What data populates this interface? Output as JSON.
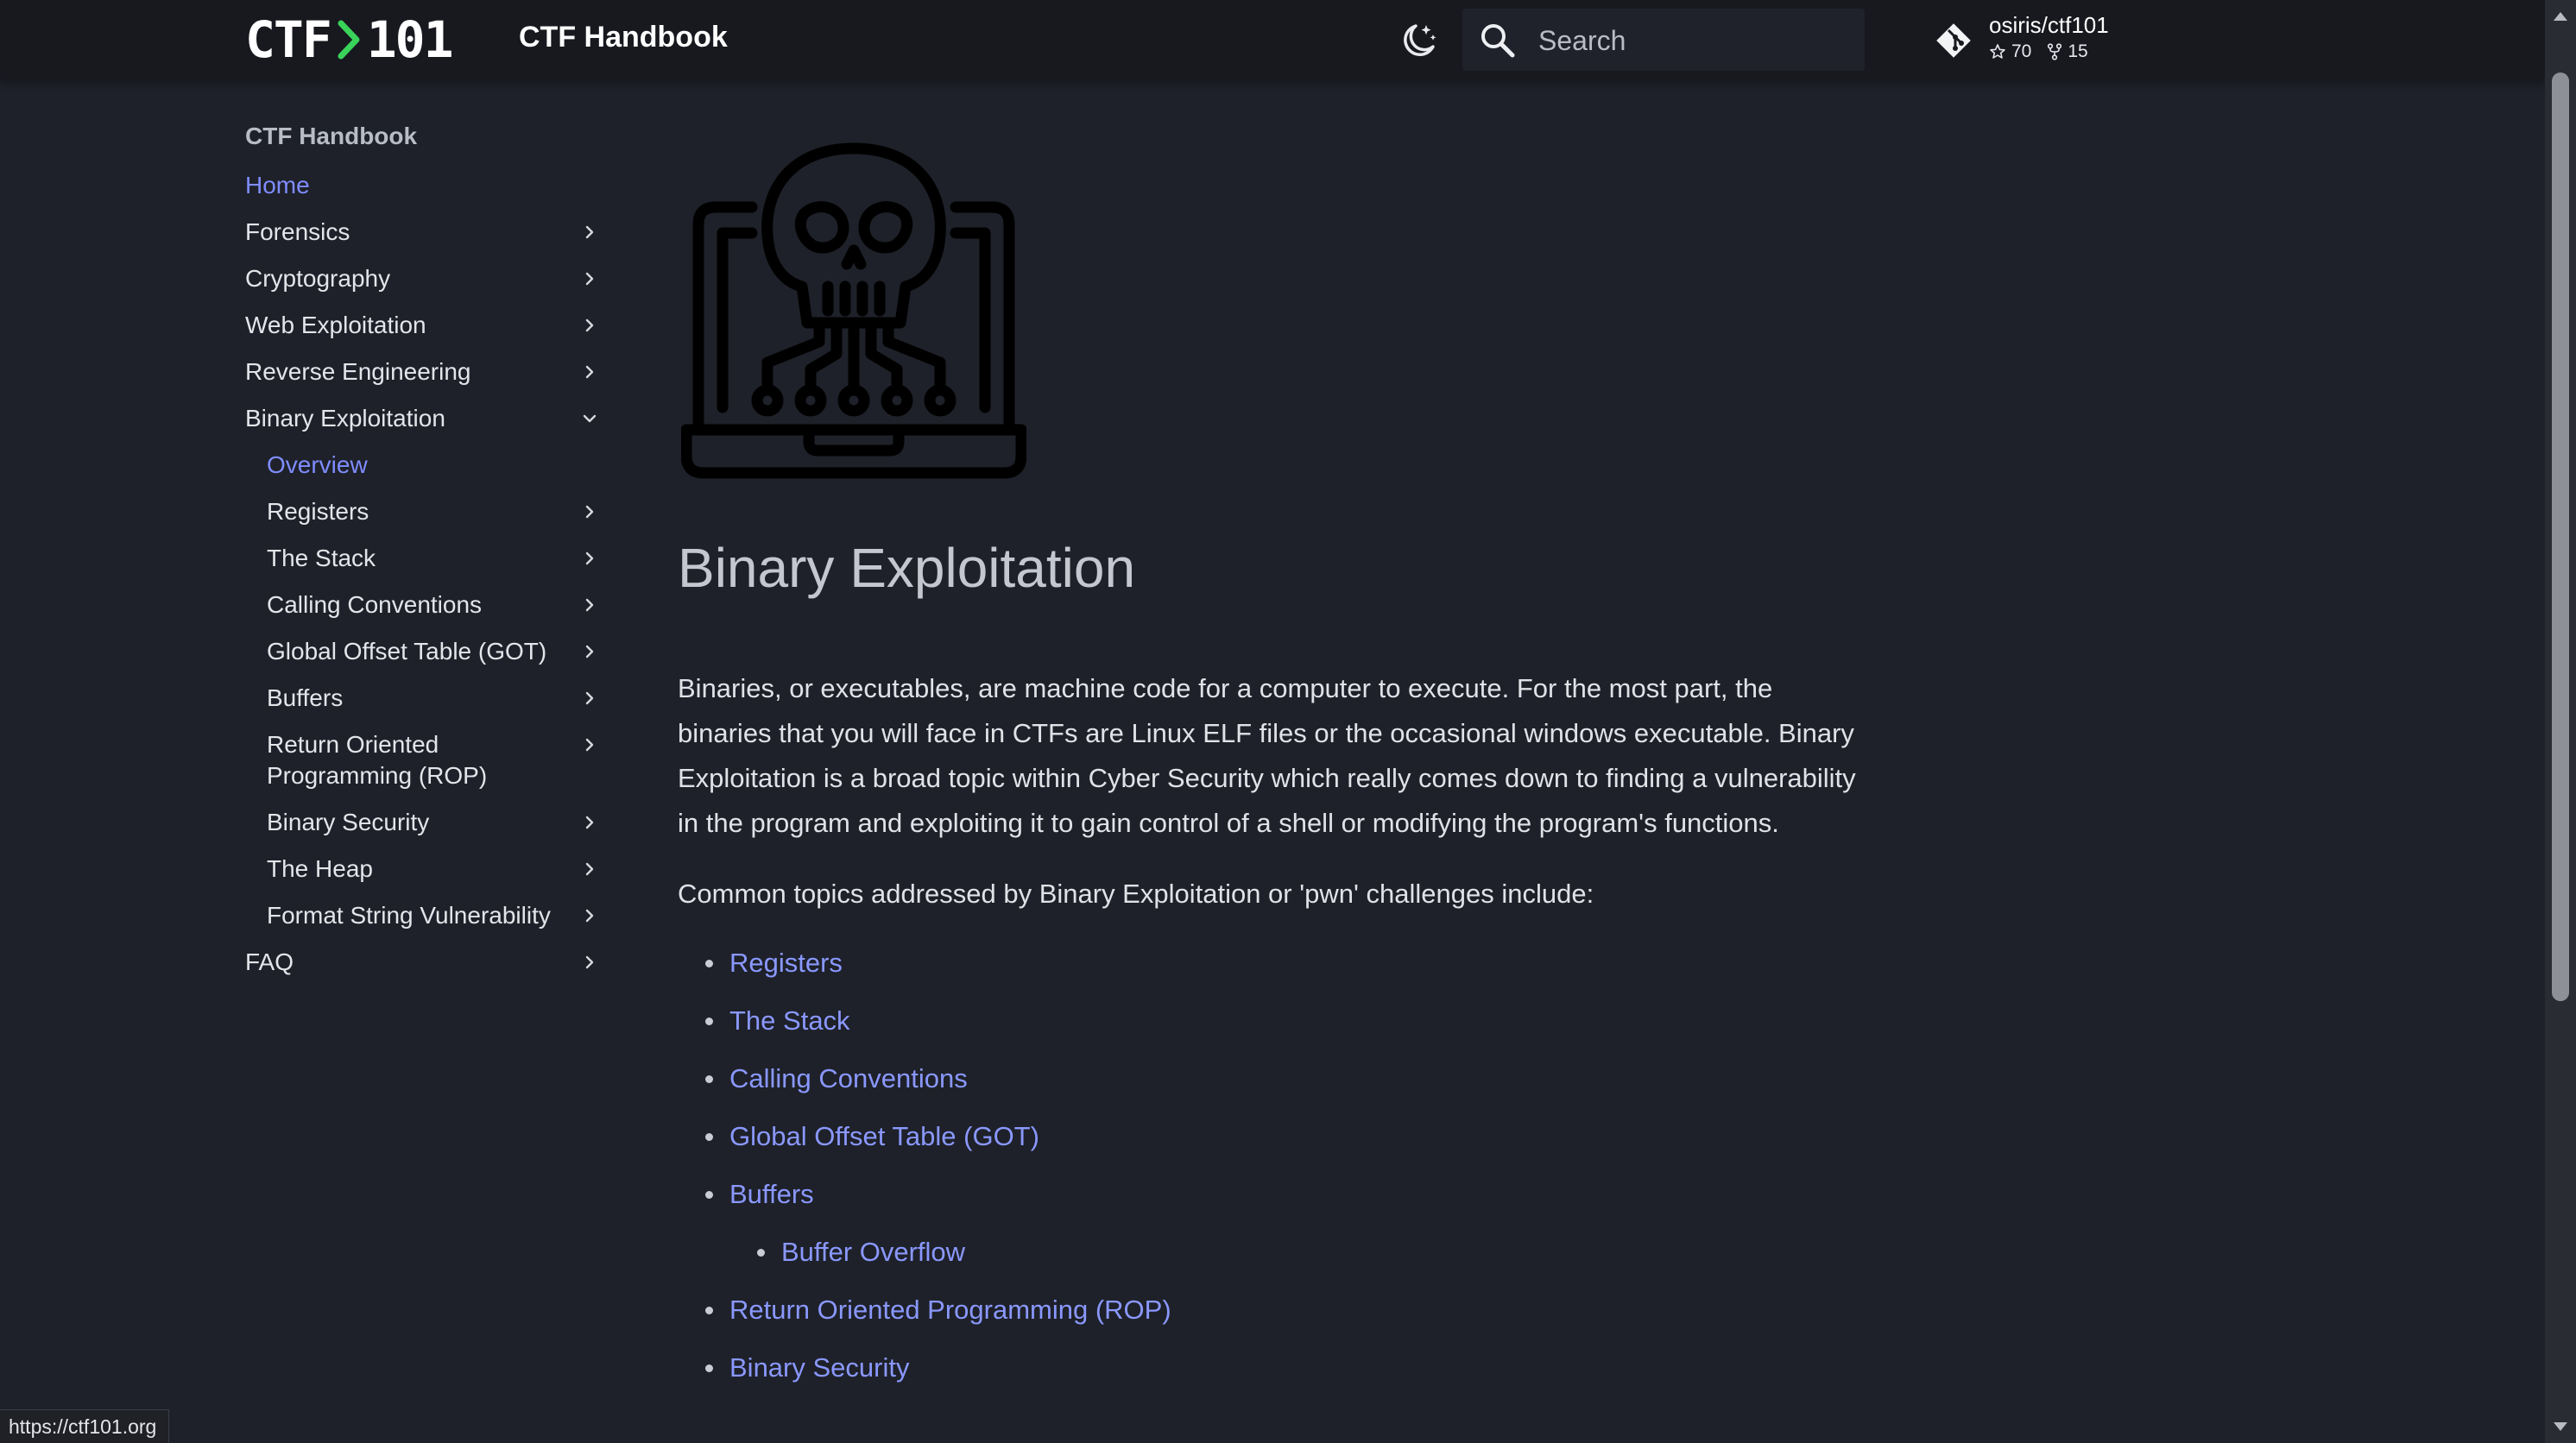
{
  "header": {
    "logo_left": "CTF",
    "logo_right": "101",
    "site_title": "CTF Handbook",
    "search_placeholder": "Search",
    "repo": {
      "name": "osiris/ctf101",
      "stars": "70",
      "forks": "15"
    }
  },
  "sidebar": {
    "heading": "CTF Handbook",
    "items": [
      {
        "label": "Home",
        "active": true,
        "level": 0,
        "chevron": "none"
      },
      {
        "label": "Forensics",
        "level": 0,
        "chevron": "right"
      },
      {
        "label": "Cryptography",
        "level": 0,
        "chevron": "right"
      },
      {
        "label": "Web Exploitation",
        "level": 0,
        "chevron": "right"
      },
      {
        "label": "Reverse Engineering",
        "level": 0,
        "chevron": "right"
      },
      {
        "label": "Binary Exploitation",
        "level": 0,
        "chevron": "down"
      },
      {
        "label": "Overview",
        "active": true,
        "level": 1,
        "chevron": "none"
      },
      {
        "label": "Registers",
        "level": 1,
        "chevron": "right"
      },
      {
        "label": "The Stack",
        "level": 1,
        "chevron": "right"
      },
      {
        "label": "Calling Conventions",
        "level": 1,
        "chevron": "right"
      },
      {
        "label": "Global Offset Table (GOT)",
        "level": 1,
        "chevron": "right"
      },
      {
        "label": "Buffers",
        "level": 1,
        "chevron": "right"
      },
      {
        "label": "Return Oriented Programming (ROP)",
        "level": 1,
        "chevron": "right"
      },
      {
        "label": "Binary Security",
        "level": 1,
        "chevron": "right"
      },
      {
        "label": "The Heap",
        "level": 1,
        "chevron": "right"
      },
      {
        "label": "Format String Vulnerability",
        "level": 1,
        "chevron": "right"
      },
      {
        "label": "FAQ",
        "level": 0,
        "chevron": "right"
      }
    ]
  },
  "main": {
    "title": "Binary Exploitation",
    "paragraph1": "Binaries, or executables, are machine code for a computer to execute. For the most part, the binaries that you will face in CTFs are Linux ELF files or the occasional windows executable. Binary Exploitation is a broad topic within Cyber Security which really comes down to finding a vulnerability in the program and exploiting it to gain control of a shell or modifying the program's functions.",
    "paragraph2": "Common topics addressed by Binary Exploitation or 'pwn' challenges include:",
    "topics": [
      {
        "label": "Registers",
        "level": 0
      },
      {
        "label": "The Stack",
        "level": 0
      },
      {
        "label": "Calling Conventions",
        "level": 0
      },
      {
        "label": "Global Offset Table (GOT)",
        "level": 0
      },
      {
        "label": "Buffers",
        "level": 0
      },
      {
        "label": "Buffer Overflow",
        "level": 1
      },
      {
        "label": "Return Oriented Programming (ROP)",
        "level": 0
      },
      {
        "label": "Binary Security",
        "level": 0
      }
    ]
  },
  "status_bar": {
    "url": "https://ctf101.org"
  },
  "colors": {
    "background": "#1e2129",
    "header_background": "#17191f",
    "accent_active": "#7f8cff",
    "link": "#8a98ff",
    "logo_chevron": "#3ad35a"
  },
  "icons": {
    "theme_toggle": "moon-stars-icon",
    "search": "search-icon",
    "repo": "git-icon",
    "stars": "star-icon",
    "forks": "fork-icon",
    "hero": "skull-laptop-icon"
  }
}
